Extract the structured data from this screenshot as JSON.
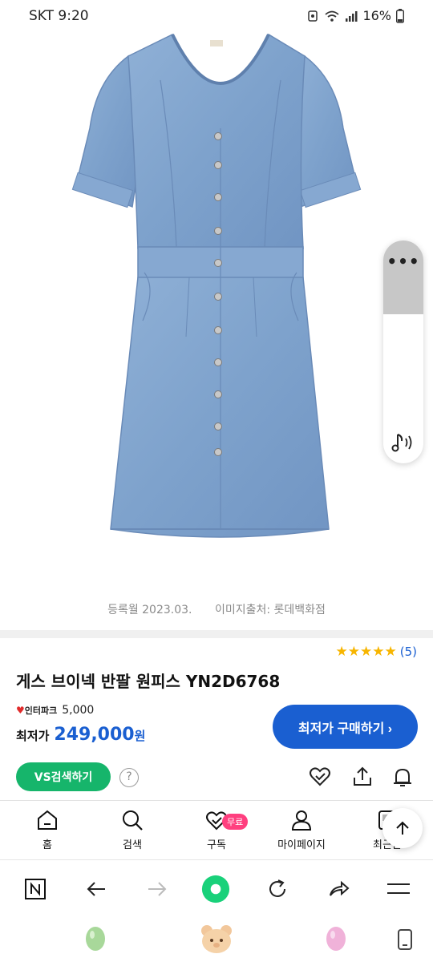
{
  "status_bar": {
    "carrier_time": "SKT 9:20",
    "battery": "16%",
    "icons": [
      "alarm-icon",
      "wifi-icon",
      "signal-icon",
      "battery-icon"
    ]
  },
  "hero": {
    "image": "denim-dress-product-image"
  },
  "caption": {
    "registered": "등록월 2023.03.",
    "image_source": "이미지출처: 롯데백화점"
  },
  "rating": {
    "stars": "★★★★★",
    "count": "(5)"
  },
  "product": {
    "title": "게스 브이넥 반팔 원피스 YN2D6768",
    "seller_logo": "인터파크",
    "seller_price": "5,000",
    "lowest_label": "최저가",
    "lowest_price": "249,000",
    "currency": "원"
  },
  "buttons": {
    "buy": "최저가 구매하기 ›",
    "vs_search": "VS검색하기",
    "help": "?"
  },
  "bottom_nav": {
    "items": [
      {
        "label": "홈",
        "icon": "home-icon"
      },
      {
        "label": "검색",
        "icon": "search-icon"
      },
      {
        "label": "구독",
        "icon": "subscribe-heart-icon",
        "badge": "무료"
      },
      {
        "label": "마이페이지",
        "icon": "user-icon"
      },
      {
        "label": "최근본",
        "icon": "recent-icon"
      }
    ]
  },
  "colors": {
    "accent_blue": "#1a5fd1",
    "vs_green": "#16b56b",
    "badge_pink": "#ff3f7f",
    "star_yellow": "#f7b500"
  }
}
